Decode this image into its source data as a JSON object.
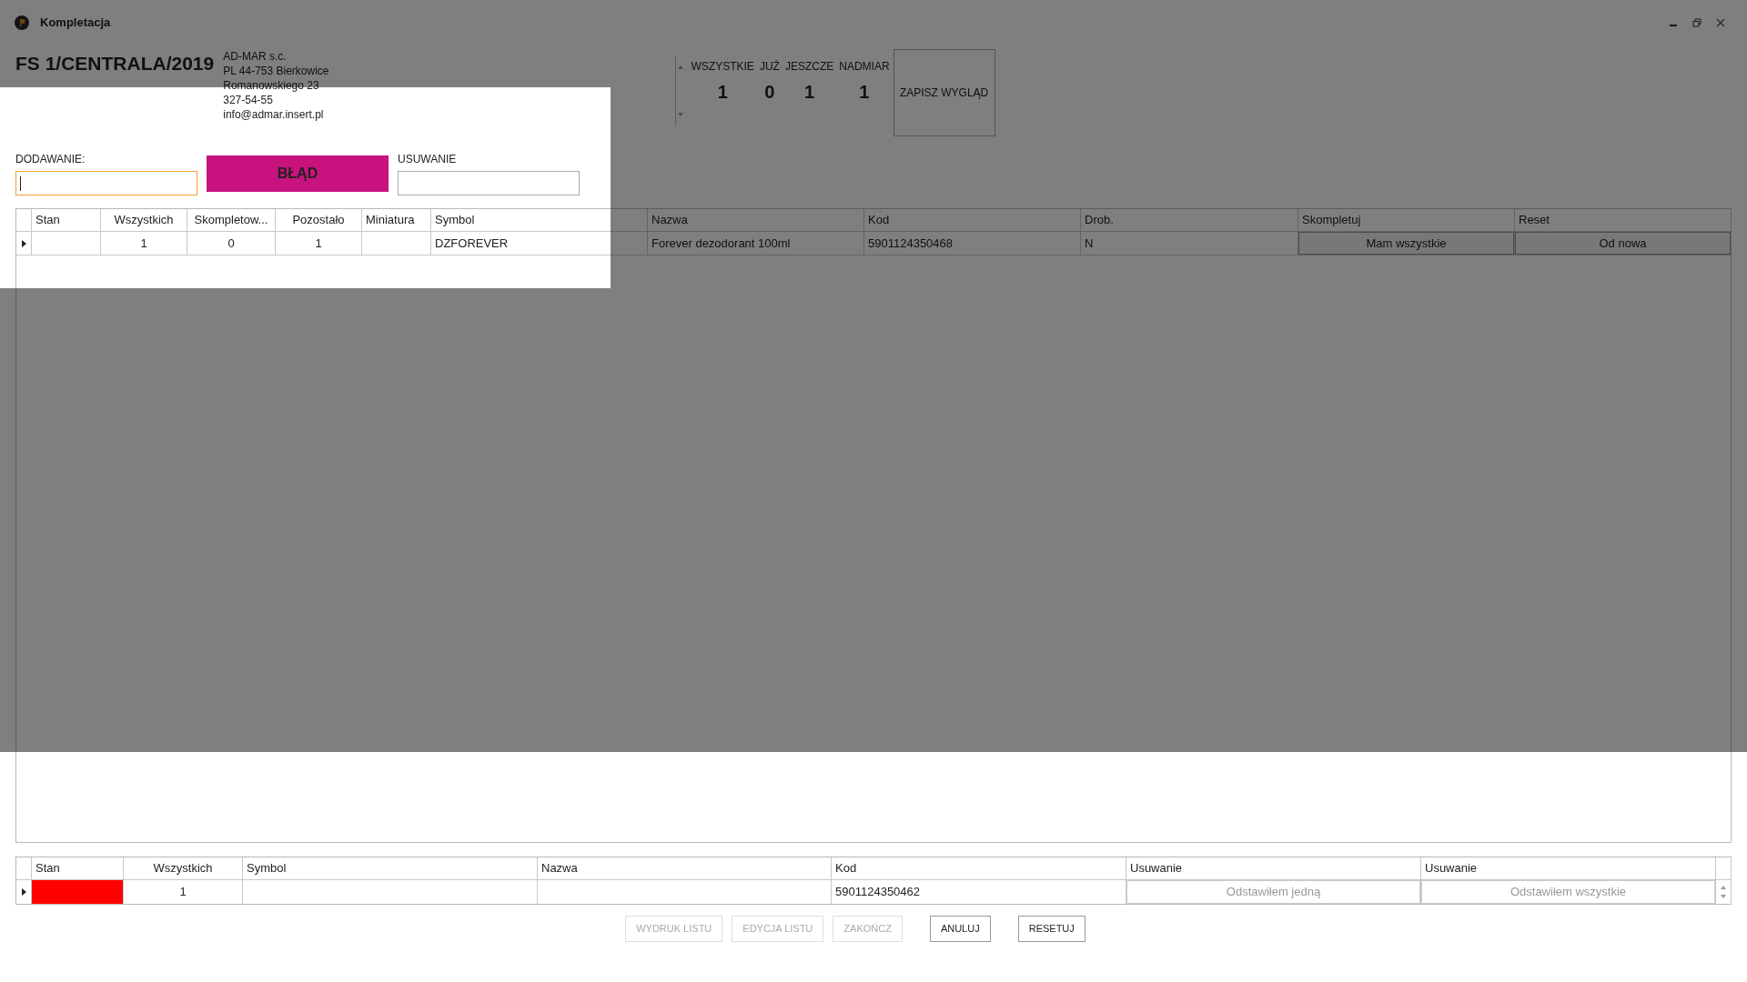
{
  "window": {
    "title": "Kompletacja"
  },
  "document": {
    "number": "FS 1/CENTRALA/2019",
    "address_lines": [
      "AD-MAR s.c.",
      "PL 44-753 Bierkowice",
      "Romanowskiego 23",
      "327-54-55",
      "info@admar.insert.pl"
    ]
  },
  "stats": [
    {
      "label": "WSZYSTKIE",
      "value": "1"
    },
    {
      "label": "JUŻ",
      "value": "0"
    },
    {
      "label": "JESZCZE",
      "value": "1"
    },
    {
      "label": "NADMIAR",
      "value": "1"
    }
  ],
  "save_layout_button": "ZAPISZ WYGLĄD",
  "adding": {
    "label": "DODAWANIE:",
    "focused": true
  },
  "error_banner": "BŁĄD",
  "removing": {
    "label": "USUWANIE"
  },
  "items_table": {
    "columns": [
      "Stan",
      "Wszystkich",
      "Skompletow...",
      "Pozostało",
      "Miniatura",
      "Symbol",
      "Nazwa",
      "Kod",
      "Drob.",
      "Skompletuj",
      "Reset"
    ],
    "rows": [
      {
        "current": true,
        "wszystkich": "1",
        "skompletowane": "0",
        "pozostalo": "1",
        "symbol": "DZFOREVER",
        "nazwa": "Forever dezodorant 100ml",
        "kod": "5901124350468",
        "drob": "N",
        "complete_button": "Mam wszystkie",
        "reset_button": "Od nowa"
      }
    ]
  },
  "removed_table": {
    "columns": [
      "Stan",
      "Wszystkich",
      "Symbol",
      "Nazwa",
      "Kod",
      "Usuwanie",
      "Usuwanie"
    ],
    "rows": [
      {
        "current": true,
        "color": "#ff0000",
        "wszystkich": "1",
        "kod": "5901124350462",
        "remove_one": {
          "label": "Odstawiłem jedną",
          "disabled": true
        },
        "remove_all": {
          "label": "Odstawiłem wszystkie",
          "disabled": true
        }
      }
    ]
  },
  "footer_buttons": [
    {
      "label": "WYDRUK LISTU",
      "disabled": true
    },
    {
      "label": "EDYCJA LISTU",
      "disabled": true
    },
    {
      "label": "ZAKOŃCZ",
      "disabled": true
    },
    {
      "label": "ANULUJ",
      "disabled": false
    },
    {
      "label": "RESETUJ",
      "disabled": false
    }
  ]
}
